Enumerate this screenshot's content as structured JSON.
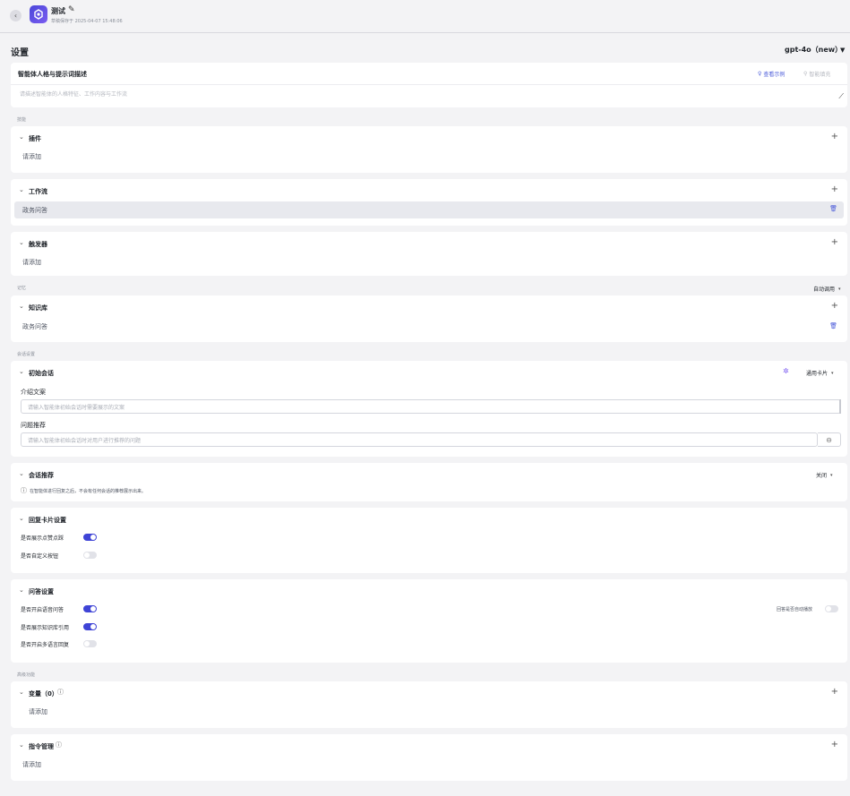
{
  "header": {
    "app_name": "测试",
    "save_status": "草稿保存于 2025-04-07 15:48:06"
  },
  "page": {
    "title": "设置",
    "model": "gpt-4o（new）"
  },
  "persona": {
    "title": "智能体人格与提示词描述",
    "view_example": "查看示例",
    "smart_fill": "智能填充",
    "placeholder": "请描述智能体的人格特征、工作内容与工作流"
  },
  "sections": {
    "skills": "技能",
    "memory": "记忆",
    "conversation": "会话设置",
    "advanced": "高级功能"
  },
  "plugins": {
    "title": "插件",
    "empty": "请添加"
  },
  "workflow": {
    "title": "工作流",
    "item": "政务问答"
  },
  "trigger": {
    "title": "触发器",
    "empty": "请添加"
  },
  "memory": {
    "mode": "自动调用"
  },
  "knowledge": {
    "title": "知识库",
    "item": "政务问答"
  },
  "opening": {
    "title": "初始会话",
    "card_type": "通用卡片",
    "intro_label": "介绍文案",
    "intro_placeholder": "请输入智能体初始会话时需要展示的文案",
    "question_label": "问题推荐",
    "question_placeholder": "请输入智能体初始会话时对用户进行推荐的问题"
  },
  "suggest": {
    "title": "会话推荐",
    "status": "关闭",
    "hint": "在智能体进行回复之后，不会有任何会话的推荐展示出来。"
  },
  "reply_card": {
    "title": "回复卡片设置",
    "opt1": "是否展示点赞点踩",
    "opt1_on": true,
    "opt2": "是否自定义按钮",
    "opt2_on": false
  },
  "qa": {
    "title": "问答设置",
    "opt1": "是否开启语音问答",
    "opt1_on": true,
    "opt2": "是否展示知识库引用",
    "opt2_on": true,
    "opt3": "是否开启多语言回复",
    "opt3_on": false,
    "autoplay": "回答是否自动播放",
    "autoplay_on": false
  },
  "variables": {
    "title": "变量（0）",
    "empty": "请添加"
  },
  "commands": {
    "title": "指令管理",
    "empty": "请添加"
  },
  "colors": {
    "accent": "#3f44d6",
    "link": "#4a5ad9"
  }
}
